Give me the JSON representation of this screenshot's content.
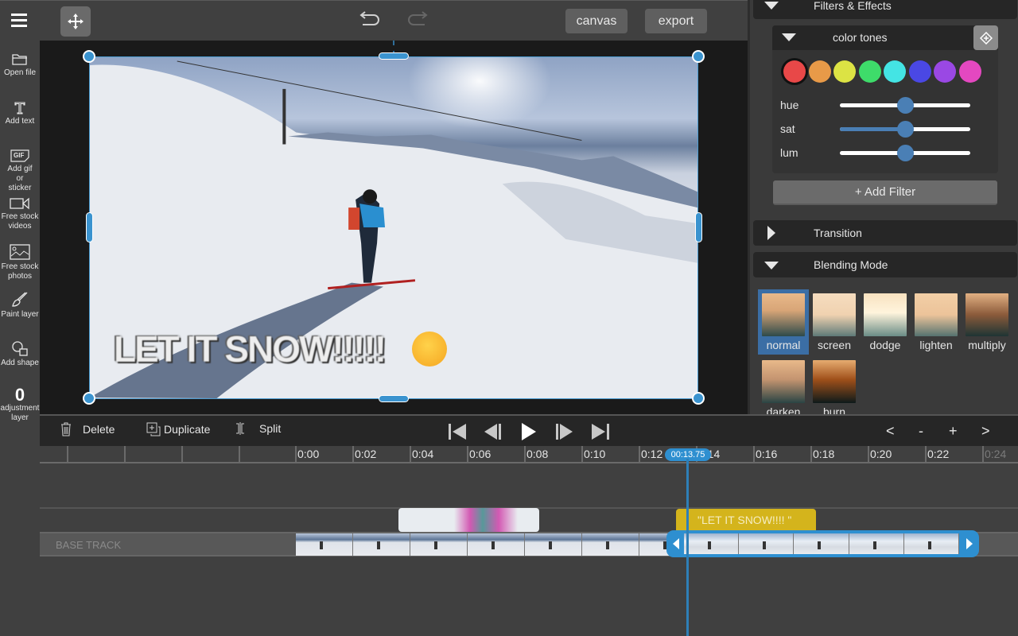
{
  "toolbar": {
    "canvas_label": "canvas",
    "export_label": "export"
  },
  "sidebar": {
    "items": [
      {
        "label": "Open file",
        "icon": "folder-icon"
      },
      {
        "label": "Add text",
        "icon": "text-icon"
      },
      {
        "label": "Add gif or sticker",
        "icon": "gif-icon"
      },
      {
        "label": "Free stock videos",
        "icon": "video-camera-icon"
      },
      {
        "label": "Free stock photos",
        "icon": "image-icon"
      },
      {
        "label": "Paint layer",
        "icon": "brush-icon"
      },
      {
        "label": "Add shape",
        "icon": "shape-icon"
      },
      {
        "label": "adjustment layer",
        "icon": "adjustment-icon",
        "glyph": "0"
      }
    ]
  },
  "canvas": {
    "overlay_text": "LET IT SNOW!!!!!"
  },
  "panel": {
    "filters_title": "Filters & Effects",
    "filter_name": "color tones",
    "swatches": [
      "#e84848",
      "#e89a48",
      "#dce344",
      "#3edc6a",
      "#44e4e4",
      "#4a48e4",
      "#9a48e4",
      "#e448c0"
    ],
    "selected_swatch": 0,
    "sliders": [
      {
        "name": "hue",
        "value": 0.5,
        "filled": false
      },
      {
        "name": "sat",
        "value": 0.5,
        "filled": true
      },
      {
        "name": "lum",
        "value": 0.5,
        "filled": false
      }
    ],
    "add_filter_label": "+ Add Filter",
    "transition_title": "Transition",
    "blending_title": "Blending Mode",
    "blend_modes": [
      "normal",
      "screen",
      "dodge",
      "lighten",
      "multiply",
      "darken",
      "burn"
    ],
    "selected_blend": "normal"
  },
  "edit_bar": {
    "delete_label": "Delete",
    "duplicate_label": "Duplicate",
    "split_label": "Split",
    "zoom_controls": [
      "<",
      "-",
      "+",
      ">"
    ]
  },
  "timeline": {
    "ticks": [
      "0:00",
      "0:02",
      "0:04",
      "0:06",
      "0:08",
      "0:10",
      "0:12",
      "0:14",
      "0:16",
      "0:18",
      "0:20",
      "0:22",
      "0:24"
    ],
    "playhead_time": "00:13.75",
    "base_track_label": "BASE TRACK",
    "text_clip_label": "\"LET IT SNOW!!!! \""
  }
}
